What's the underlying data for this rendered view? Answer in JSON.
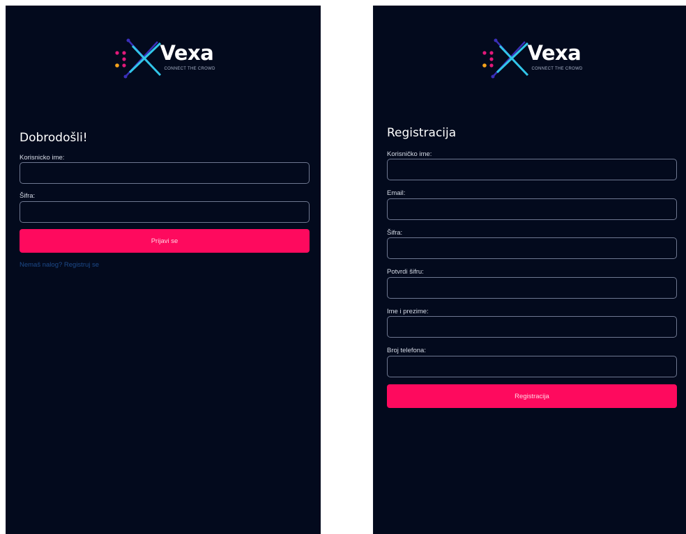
{
  "brand": {
    "name": "Vexa",
    "tagline": "CONNECT THE CROWD",
    "colors": {
      "background": "#030a1d",
      "accent": "#fe0a5e",
      "link": "#1d4a8a",
      "logo_cyan": "#31c6e8",
      "logo_purple": "#3a2fb8",
      "logo_pink": "#e2197a",
      "logo_orange": "#f5a21b"
    }
  },
  "login": {
    "title": "Dobrodošli!",
    "username_label": "Korisnicko ime:",
    "username_value": "",
    "password_label": "Šifra:",
    "password_value": "",
    "submit_label": "Prijavi se",
    "register_link": "Nemaš nalog? Registruj se"
  },
  "register": {
    "title": "Registracija",
    "fields": [
      {
        "label": "Korisničko ime:",
        "value": ""
      },
      {
        "label": "Email:",
        "value": ""
      },
      {
        "label": "Šifra:",
        "value": ""
      },
      {
        "label": "Potvrdi šifru:",
        "value": ""
      },
      {
        "label": "Ime i prezime:",
        "value": ""
      },
      {
        "label": "Broj telefona:",
        "value": ""
      }
    ],
    "submit_label": "Registracija"
  }
}
